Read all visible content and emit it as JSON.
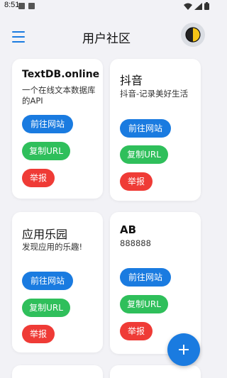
{
  "status_bar": {
    "time": "8:51"
  },
  "header": {
    "title": "用户社区"
  },
  "icons": {
    "menu": "hamburger-menu-icon",
    "theme": "half-moon-icon",
    "add": "plus-icon",
    "wifi": "wifi-icon",
    "signal": "signal-icon",
    "battery": "battery-icon"
  },
  "colors": {
    "accent": "#1a7be0",
    "visit": "#1a7be0",
    "copy": "#2fbf5b",
    "report": "#ef3b36",
    "background": "#f2f2f6"
  },
  "cards": [
    {
      "title": "TextDB.online",
      "description": "一个在线文本数据库的API",
      "visit_label": "前往网站",
      "copy_label": "复制URL",
      "report_label": "举报"
    },
    {
      "title": "抖音",
      "description": "抖音-记录美好生活",
      "visit_label": "前往网站",
      "copy_label": "复制URL",
      "report_label": "举报"
    },
    {
      "title": "应用乐园",
      "description": "发现应用的乐趣!",
      "visit_label": "前往网站",
      "copy_label": "复制URL",
      "report_label": "举报"
    },
    {
      "title": "AB",
      "description": "888888",
      "visit_label": "前往网站",
      "copy_label": "复制URL",
      "report_label": "举报"
    }
  ]
}
